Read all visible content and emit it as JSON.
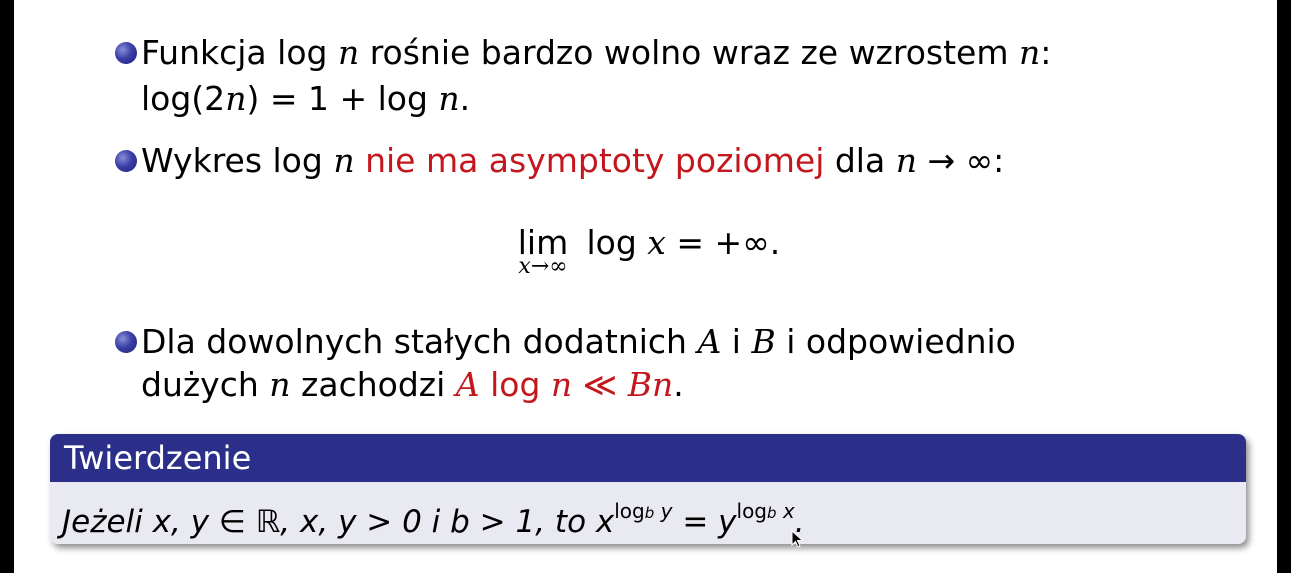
{
  "bullets": [
    {
      "line1": {
        "a": "Funkcja ",
        "log": "log",
        "n1": " n",
        "b": " rośnie bardzo wolno wraz ze wzrostem ",
        "n2": "n",
        "c": ":"
      },
      "line2": {
        "a": "log(2",
        "n": "n",
        "b": ") = 1 + log ",
        "n2": "n",
        "c": "."
      }
    },
    {
      "line1": {
        "a": "Wykres log ",
        "n": "n",
        "red": " nie ma asymptoty poziomej",
        "b": " dla ",
        "n2": "n",
        "arrow": " → ∞:"
      }
    },
    {
      "line1": {
        "a": "Dla dowolnych stałych dodatnich ",
        "A": "A",
        "i": " i ",
        "B": "B",
        "b": " i odpowiednio"
      },
      "line2": {
        "a": "dużych ",
        "n": "n",
        "b": " zachodzi ",
        "red_A": "A",
        "red_log": " log ",
        "red_n": "n",
        "red_ll": " ≪ ",
        "red_Bn": "Bn",
        "c": "."
      }
    }
  ],
  "formula": {
    "lim": "lim",
    "sub": "x→∞",
    "body_log": " log ",
    "x": "x",
    "rest": " = +∞."
  },
  "theorem": {
    "title": "Twierdzenie",
    "body_a": "Jeżeli x, y ∈ ℝ, x, y > 0 i b > 1, to x",
    "sup1": "log",
    "sup1_b": "b",
    "sup1_y": " y",
    "mid": " = y",
    "sup2": "log",
    "sup2_b": "b",
    "sup2_x": " x",
    "end": "."
  }
}
